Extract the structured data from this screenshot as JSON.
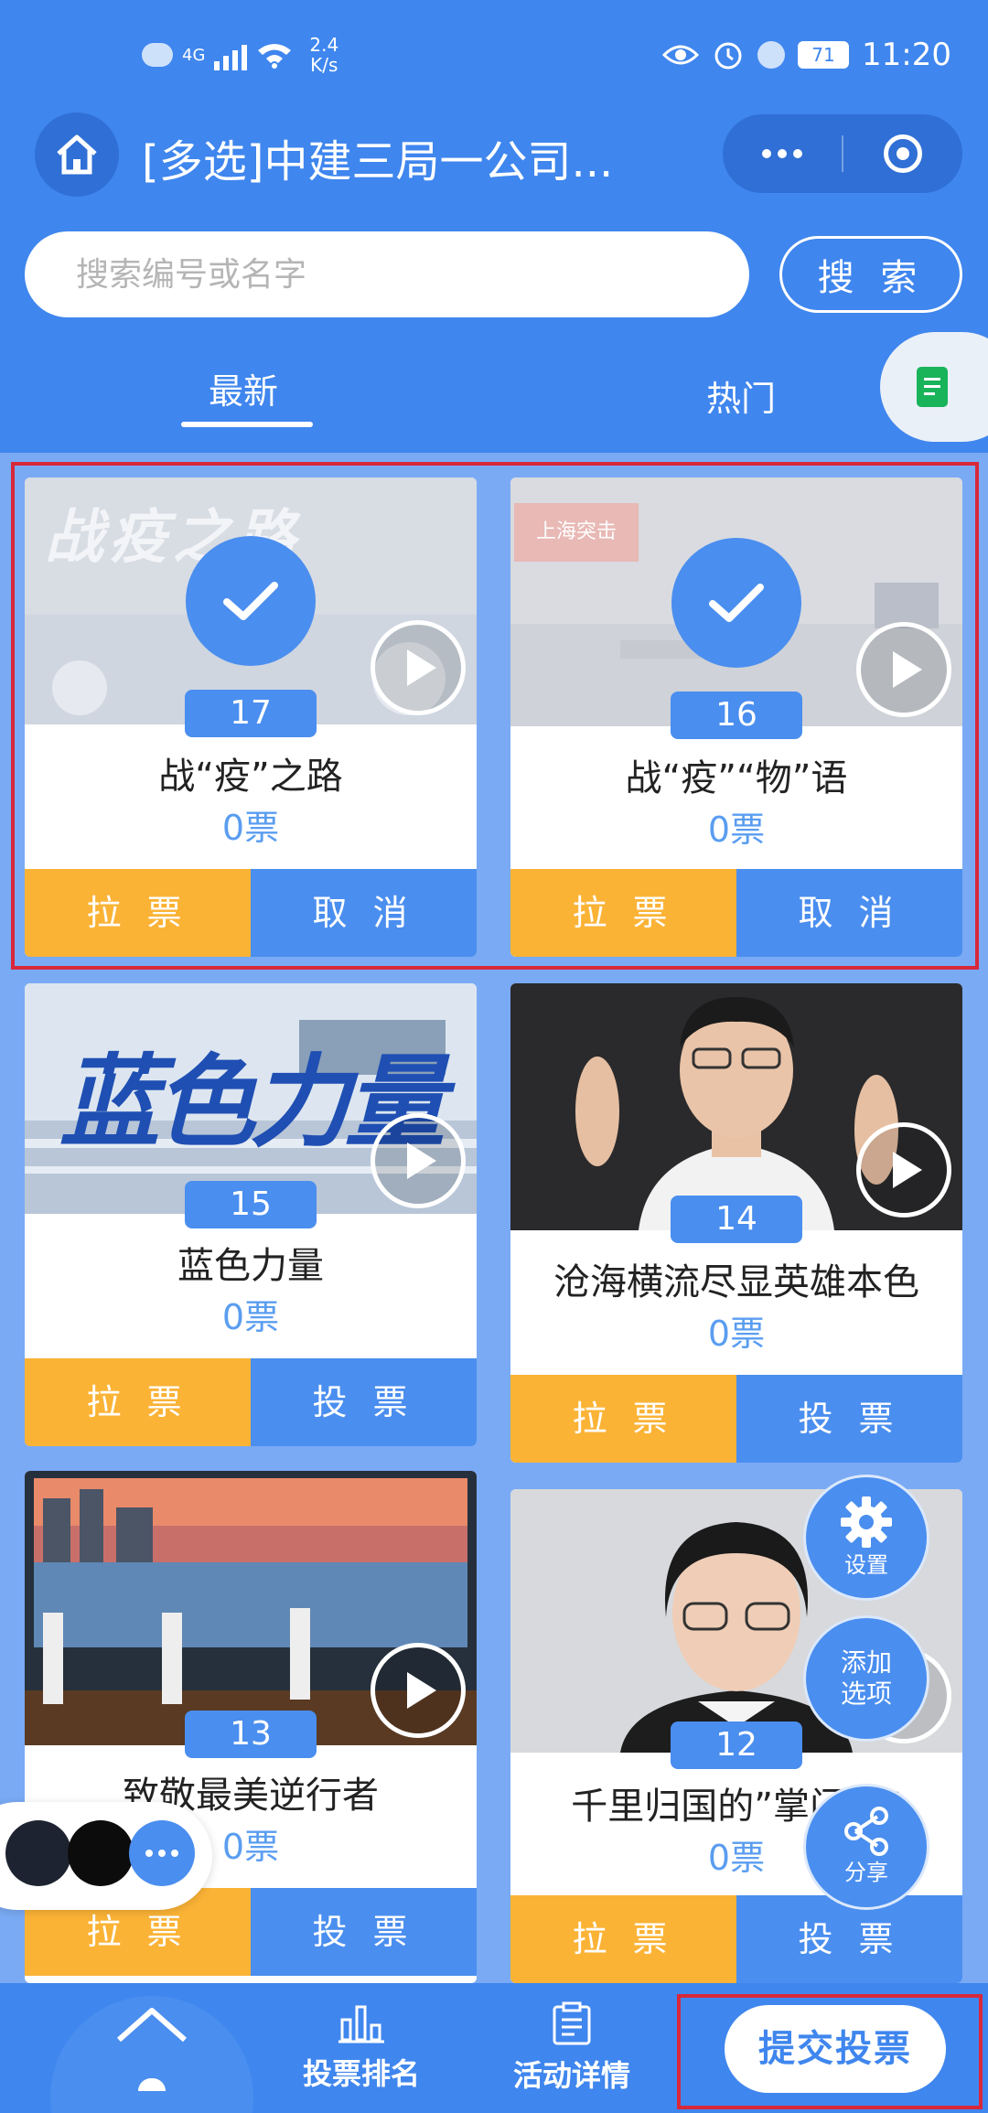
{
  "status_bar": {
    "network": "4G",
    "speed_value": "2.4",
    "speed_unit": "K/s",
    "battery": "71",
    "time": "11:20"
  },
  "nav": {
    "title": "[多选]中建三局一公司..."
  },
  "search": {
    "placeholder": "搜索编号或名字",
    "button": "搜 索"
  },
  "tabs": [
    {
      "label": "最新",
      "active": true
    },
    {
      "label": "热门",
      "active": false
    }
  ],
  "cards": [
    {
      "number": "17",
      "title": "战“疫”之路",
      "votes": "0票",
      "selected": true,
      "btn_left": "拉 票",
      "btn_right": "取 消"
    },
    {
      "number": "16",
      "title": "战“疫”“物”语",
      "votes": "0票",
      "selected": true,
      "btn_left": "拉 票",
      "btn_right": "取 消"
    },
    {
      "number": "15",
      "title": "蓝色力量",
      "votes": "0票",
      "selected": false,
      "btn_left": "拉 票",
      "btn_right": "投 票"
    },
    {
      "number": "14",
      "title": "沧海横流尽显英雄本色",
      "votes": "0票",
      "selected": false,
      "btn_left": "拉 票",
      "btn_right": "投 票"
    },
    {
      "number": "13",
      "title": "致敬最美逆行者",
      "votes": "0票",
      "selected": false,
      "btn_left": "拉 票",
      "btn_right": "投 票"
    },
    {
      "number": "12",
      "title": "千里归国的”掌门人“",
      "votes": "0票",
      "selected": false,
      "btn_left": "拉 票",
      "btn_right": "投 票"
    }
  ],
  "card_thumb_text": {
    "c17": "战疫之路",
    "c16_banner": "上海突击",
    "c15": "蓝色力量"
  },
  "float_buttons": {
    "settings": "设置",
    "add_option_1": "添加",
    "add_option_2": "选项",
    "share": "分享"
  },
  "bottom_bar": {
    "rank": "投票排名",
    "details": "活动详情",
    "submit": "提交投票"
  },
  "colors": {
    "primary": "#3f86ee",
    "card_blue": "#4a8eef",
    "orange": "#fbb336",
    "highlight_red": "#d8283a",
    "page_bg": "#7aaaf4"
  }
}
